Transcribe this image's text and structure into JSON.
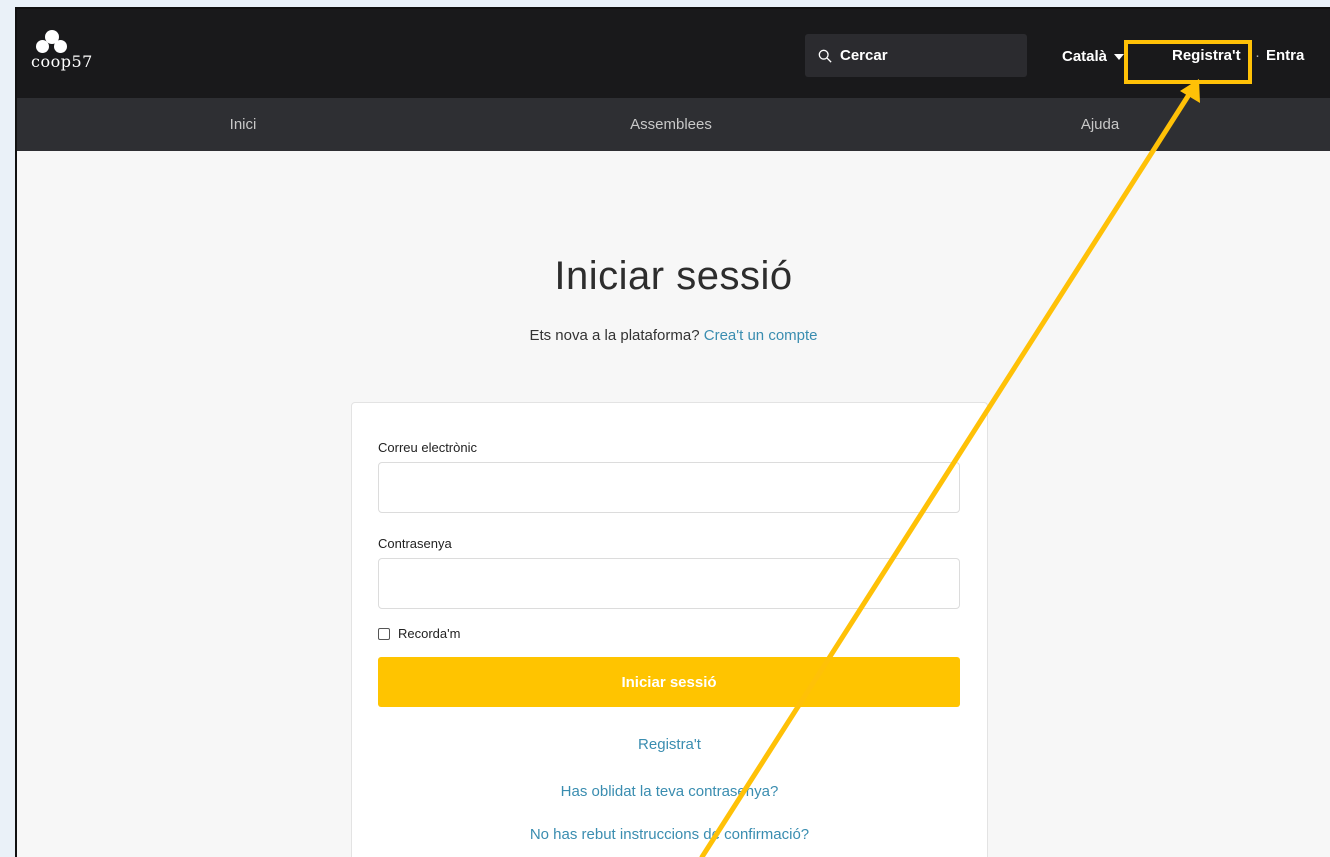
{
  "header": {
    "logo_text": "coop57",
    "search_placeholder": "Cercar",
    "language": "Català",
    "register_label": "Registra't",
    "separator": "·",
    "login_label": "Entra"
  },
  "nav": {
    "items": [
      {
        "label": "Inici"
      },
      {
        "label": "Assemblees"
      },
      {
        "label": "Ajuda"
      }
    ]
  },
  "main": {
    "title": "Iniciar sessió",
    "subtitle_text": "Ets nova a la plataforma?",
    "subtitle_link": "Crea't un compte"
  },
  "form": {
    "email_label": "Correu electrònic",
    "email_value": "",
    "password_label": "Contrasenya",
    "password_value": "",
    "remember_label": "Recorda'm",
    "remember_checked": false,
    "submit_label": "Iniciar sessió",
    "register_link": "Registra't",
    "forgot_link": "Has oblidat la teva contrasenya?",
    "confirm_link": "No has rebut instruccions de confirmació?"
  },
  "annotation": {
    "color": "#ffc107"
  },
  "colors": {
    "topbar": "#19191b",
    "navbar": "#2e2f33",
    "accent": "#ffc400",
    "link": "#3a8db0"
  }
}
